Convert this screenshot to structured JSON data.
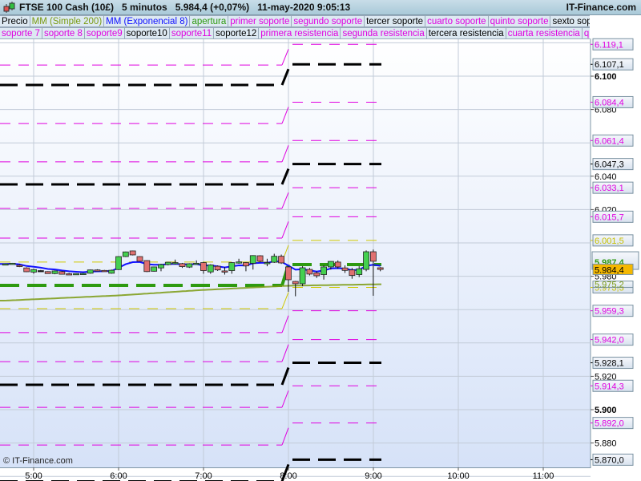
{
  "header": {
    "title": "FTSE 100 Cash (10£)   5 minutos   5.984,4 (+0,07%)   11-may-2020 9:05:13",
    "brand": "IT-Finance.com"
  },
  "legend_row1": [
    {
      "label": "Precio",
      "color": "#000000"
    },
    {
      "label": "MM (Simple 200)",
      "color": "#7a9a10"
    },
    {
      "label": "MM (Exponencial 8)",
      "color": "#1010ff"
    },
    {
      "label": "apertura",
      "color": "#2e9a10"
    },
    {
      "label": "primer soporte",
      "color": "#e000e0"
    },
    {
      "label": "segundo soporte",
      "color": "#e000e0"
    },
    {
      "label": "tercer soporte",
      "color": "#000000"
    },
    {
      "label": "cuarto soporte",
      "color": "#e000e0"
    },
    {
      "label": "quinto soporte",
      "color": "#e000e0"
    },
    {
      "label": "sexto soporte",
      "color": "#000000"
    }
  ],
  "legend_row2": [
    {
      "label": "soporte 7",
      "color": "#e000e0"
    },
    {
      "label": "soporte 8",
      "color": "#e000e0"
    },
    {
      "label": "soporte9",
      "color": "#e000e0"
    },
    {
      "label": "soporte10",
      "color": "#000000"
    },
    {
      "label": "soporte11",
      "color": "#e000e0"
    },
    {
      "label": "soporte12",
      "color": "#000000"
    },
    {
      "label": "primera resistencia",
      "color": "#e000e0"
    },
    {
      "label": "segunda resistencia",
      "color": "#e000e0"
    },
    {
      "label": "tercera resistencia",
      "color": "#000000"
    },
    {
      "label": "cuarta resistencia",
      "color": "#e000e0"
    },
    {
      "label": "quinta r",
      "color": "#e000e0"
    }
  ],
  "watermark": "© IT-Finance.com",
  "chart_data": {
    "type": "candlestick",
    "interval": "5 minutos",
    "start_time": "4:40",
    "x_ticks": [
      "5:00",
      "6:00",
      "7:00",
      "8:00",
      "9:00",
      "10:00",
      "11:00"
    ],
    "y_ticks": [
      {
        "v": 6100,
        "label": "6.100",
        "bold": true
      },
      {
        "v": 6080,
        "label": "6.080"
      },
      {
        "v": 6040,
        "label": "6.040"
      },
      {
        "v": 6020,
        "label": "6.020"
      },
      {
        "v": 5980,
        "label": "5.980"
      },
      {
        "v": 5920,
        "label": "5.920"
      },
      {
        "v": 5900,
        "label": "5.900",
        "bold": true
      },
      {
        "v": 5880,
        "label": "5.880"
      }
    ],
    "ylim": [
      5855,
      6125
    ],
    "candles": [
      [
        5987.2,
        5987.6,
        5986.8,
        5987.4
      ],
      [
        5987.5,
        5988,
        5987,
        5987.8
      ],
      [
        5986.6,
        5987.2,
        5985.5,
        5985.8
      ],
      [
        5985,
        5985.4,
        5982.5,
        5982.7
      ],
      [
        5982.5,
        5984.5,
        5981.5,
        5984
      ],
      [
        5983.4,
        5983.8,
        5983,
        5983.4
      ],
      [
        5982.8,
        5983,
        5981.5,
        5981.6
      ],
      [
        5981.6,
        5983.5,
        5981.2,
        5983.2
      ],
      [
        5982.8,
        5983.2,
        5981,
        5981.2
      ],
      [
        5981.5,
        5982,
        5981,
        5981.4
      ],
      [
        5981.5,
        5981.8,
        5981.2,
        5981.6
      ],
      [
        5981.6,
        5982,
        5981.3,
        5981.7
      ],
      [
        5981.8,
        5984,
        5981.5,
        5983.8
      ],
      [
        5983.8,
        5984.2,
        5983.2,
        5983.6
      ],
      [
        5983.5,
        5983.8,
        5983,
        5983.3
      ],
      [
        5981.8,
        5984,
        5981.5,
        5983.6
      ],
      [
        5984,
        5992,
        5983.8,
        5991.8
      ],
      [
        5991.8,
        5994.8,
        5991.5,
        5994.6
      ],
      [
        5995.2,
        5995.4,
        5992.5,
        5992.8
      ],
      [
        5991.8,
        5992,
        5988.8,
        5989
      ],
      [
        5989.4,
        5989.6,
        5982.5,
        5982.8
      ],
      [
        5983,
        5985.8,
        5982.8,
        5985.6
      ],
      [
        5985,
        5987.5,
        5983,
        5987
      ],
      [
        5987,
        5988.6,
        5986.5,
        5988.4
      ],
      [
        5988,
        5990,
        5987,
        5988.2
      ],
      [
        5987.6,
        5988,
        5985,
        5985.8
      ],
      [
        5985.5,
        5987.8,
        5985,
        5987.5
      ],
      [
        5987.6,
        5989.5,
        5987,
        5987.8
      ],
      [
        5988.2,
        5988.5,
        5981.5,
        5983.4
      ],
      [
        5982.6,
        5987.2,
        5981.5,
        5986.8
      ],
      [
        5986,
        5986.5,
        5983.2,
        5983.8
      ],
      [
        5983.2,
        5985.5,
        5981,
        5983
      ],
      [
        5983.4,
        5988.5,
        5981.5,
        5988.2
      ],
      [
        5988.4,
        5990.5,
        5987.5,
        5988.6
      ],
      [
        5988.2,
        5988.5,
        5983,
        5986.2
      ],
      [
        5987.8,
        5992.6,
        5984,
        5992.4
      ],
      [
        5992.3,
        5992.6,
        5988.4,
        5989
      ],
      [
        5988,
        5990.5,
        5986,
        5988.2
      ],
      [
        5988.4,
        5993.5,
        5988,
        5992
      ],
      [
        5992,
        5993,
        5987.4,
        5988
      ],
      [
        5985.6,
        5986,
        5970.7,
        5977.9
      ],
      [
        5976.9,
        5977.2,
        5968,
        5975.5
      ],
      [
        5975.5,
        5986,
        5974,
        5985.1
      ],
      [
        5984.1,
        5985,
        5980.5,
        5981.3
      ],
      [
        5982,
        5983,
        5979,
        5980.3
      ],
      [
        5981,
        5986.5,
        5978,
        5985.6
      ],
      [
        5985.6,
        5989,
        5984,
        5988.9
      ],
      [
        5988.5,
        5989.5,
        5984.5,
        5985.6
      ],
      [
        5985,
        5986.5,
        5982,
        5983.5
      ],
      [
        5983.8,
        5985,
        5978.5,
        5980.5
      ],
      [
        5981,
        5986,
        5979.5,
        5984.5
      ],
      [
        5984.1,
        5995.5,
        5983,
        5994.7
      ],
      [
        5994.7,
        5996,
        5968.3,
        5989
      ],
      [
        5985.1,
        5985.5,
        5983,
        5984.1
      ]
    ],
    "ma200_points": [
      [
        0,
        5965.4
      ],
      [
        16,
        5968.5
      ],
      [
        28,
        5971.8
      ],
      [
        40,
        5974.3
      ],
      [
        53,
        5975.2
      ]
    ],
    "ema_period": 8,
    "levels": [
      {
        "name": "resistencia-6",
        "prev": 6106.7,
        "cur": 6119.1,
        "label": "6.119,1",
        "color": "#e000e0",
        "style": "thin"
      },
      {
        "name": "tercera-resistencia",
        "prev": 6094.7,
        "cur": 6107.1,
        "label": "6.107,1",
        "color": "#000000",
        "style": "thick"
      },
      {
        "name": "resistencia-4",
        "prev": 6071.6,
        "cur": 6084.4,
        "label": "6.084,4",
        "color": "#e000e0",
        "style": "thin"
      },
      {
        "name": "resistencia-3",
        "prev": 6048.6,
        "cur": 6061.4,
        "label": "6.061,4",
        "color": "#e000e0",
        "style": "thin"
      },
      {
        "name": "resistencia-black-2",
        "prev": 6035.1,
        "cur": 6047.3,
        "label": "6.047,3",
        "color": "#000000",
        "style": "thick"
      },
      {
        "name": "segunda-resistencia",
        "prev": 6020.7,
        "cur": 6033.1,
        "label": "6.033,1",
        "color": "#e000e0",
        "style": "thin"
      },
      {
        "name": "primera-resistencia",
        "prev": 6002.9,
        "cur": 6015.7,
        "label": "6.015,7",
        "color": "#e000e0",
        "style": "thin"
      },
      {
        "name": "yellow-upper",
        "prev": 5988.5,
        "cur": 6001.5,
        "label": "6.001,5",
        "color": "#d0c800",
        "style": "thinY"
      },
      {
        "name": "apertura",
        "prev": 5974.5,
        "cur": 5987.0,
        "label": "5.987,4",
        "color": "#2e9a10",
        "style": "green"
      },
      {
        "name": "yellow-lower",
        "prev": 5960.6,
        "cur": 5973.3,
        "label": "5.973,3",
        "color": "#d0c800",
        "style": "thinY"
      },
      {
        "name": "primer-soporte",
        "prev": 5946.2,
        "cur": 5959.3,
        "label": "5.959,3",
        "color": "#e000e0",
        "style": "thin"
      },
      {
        "name": "segundo-soporte",
        "prev": 5928.8,
        "cur": 5942.0,
        "label": "5.942,0",
        "color": "#e000e0",
        "style": "thin"
      },
      {
        "name": "tercer-soporte",
        "prev": 5914.9,
        "cur": 5928.1,
        "label": "5.928,1",
        "color": "#000000",
        "style": "thick"
      },
      {
        "name": "cuarto-soporte",
        "prev": 5901.4,
        "cur": 5914.3,
        "label": "5.914,3",
        "color": "#e000e0",
        "style": "thin"
      },
      {
        "name": "quinto-soporte",
        "prev": 5878.8,
        "cur": 5892.0,
        "label": "5.892,0",
        "color": "#e000e0",
        "style": "thin"
      },
      {
        "name": "sexto-soporte",
        "prev": 5857.0,
        "cur": 5870.0,
        "label": "5.870,0",
        "color": "#000000",
        "style": "thick"
      }
    ],
    "current_price": {
      "value": 5984.4,
      "label": "5.984,4",
      "color": "#f5b800"
    },
    "ma200_label": {
      "value": 5975.2,
      "label": "5.975,2"
    }
  }
}
